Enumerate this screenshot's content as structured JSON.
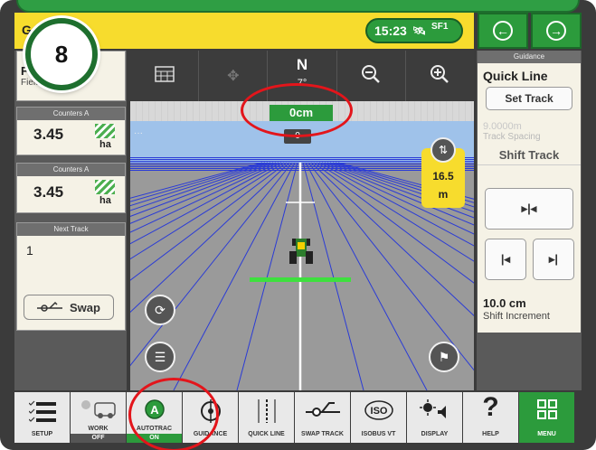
{
  "step_badge": "8",
  "topbar": {
    "title": "G",
    "time": "15:23",
    "signal": "SF1"
  },
  "field": {
    "name": "F",
    "sub": "Field"
  },
  "counters": [
    {
      "header": "Counters A",
      "value": "3.45",
      "unit": "ha"
    },
    {
      "header": "Counters A",
      "value": "3.45",
      "unit": "ha"
    }
  ],
  "next_track": {
    "header": "Next Track",
    "value": "1",
    "swap_label": "Swap"
  },
  "map": {
    "compass_dir": "N",
    "heading": "7°",
    "offset": "0cm",
    "track_number": "0",
    "more": "···",
    "distance_value": "16.5",
    "distance_unit": "m"
  },
  "guidance_panel": {
    "header": "Guidance",
    "title": "Quick Line",
    "set_track": "Set Track",
    "track_spacing_value": "9.0000m",
    "track_spacing_label": "Track Spacing",
    "shift_track": "Shift Track",
    "shift_increment_value": "10.0 cm",
    "shift_increment_label": "Shift Increment"
  },
  "bottombar": [
    {
      "label": "SETUP"
    },
    {
      "label": "WORK",
      "state": "OFF"
    },
    {
      "label": "AUTOTRAC",
      "state": "ON"
    },
    {
      "label": "GUIDANCE"
    },
    {
      "label": "QUICK LINE"
    },
    {
      "label": "SWAP TRACK"
    },
    {
      "label": "ISOBUS VT"
    },
    {
      "label": "DISPLAY"
    },
    {
      "label": "HELP"
    },
    {
      "label": "MENU"
    }
  ],
  "colors": {
    "jd_green": "#2c9b3c",
    "jd_yellow": "#f7dc2d",
    "annotation_red": "#e3151b"
  }
}
